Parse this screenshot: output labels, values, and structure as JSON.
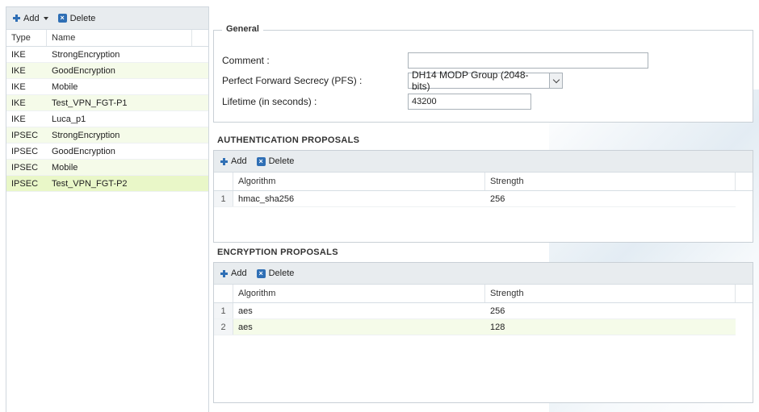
{
  "left": {
    "toolbar": {
      "add_label": "Add",
      "delete_label": "Delete"
    },
    "columns": {
      "type": "Type",
      "name": "Name"
    },
    "rows": [
      {
        "type": "IKE",
        "name": "StrongEncryption"
      },
      {
        "type": "IKE",
        "name": "GoodEncryption"
      },
      {
        "type": "IKE",
        "name": "Mobile"
      },
      {
        "type": "IKE",
        "name": "Test_VPN_FGT-P1"
      },
      {
        "type": "IKE",
        "name": "Luca_p1"
      },
      {
        "type": "IPSEC",
        "name": "StrongEncryption"
      },
      {
        "type": "IPSEC",
        "name": "GoodEncryption"
      },
      {
        "type": "IPSEC",
        "name": "Mobile"
      },
      {
        "type": "IPSEC",
        "name": "Test_VPN_FGT-P2"
      }
    ],
    "selected_index": 8
  },
  "general": {
    "legend": "General",
    "comment_label": "Comment :",
    "comment_value": "",
    "pfs_label": "Perfect Forward Secrecy (PFS) :",
    "pfs_value": "DH14 MODP Group (2048-bits)",
    "lifetime_label": "Lifetime (in seconds) :",
    "lifetime_value": "43200"
  },
  "auth": {
    "title": "AUTHENTICATION PROPOSALS",
    "add_label": "Add",
    "delete_label": "Delete",
    "col_algorithm": "Algorithm",
    "col_strength": "Strength",
    "rows": [
      {
        "num": "1",
        "algorithm": "hmac_sha256",
        "strength": "256"
      }
    ]
  },
  "enc": {
    "title": "ENCRYPTION PROPOSALS",
    "add_label": "Add",
    "delete_label": "Delete",
    "col_algorithm": "Algorithm",
    "col_strength": "Strength",
    "rows": [
      {
        "num": "1",
        "algorithm": "aes",
        "strength": "256"
      },
      {
        "num": "2",
        "algorithm": "aes",
        "strength": "128"
      }
    ]
  },
  "colors": {
    "accent": "#2f6fb5",
    "row_alt": "#f5fbe9",
    "row_selected": "#e9f7c8"
  }
}
